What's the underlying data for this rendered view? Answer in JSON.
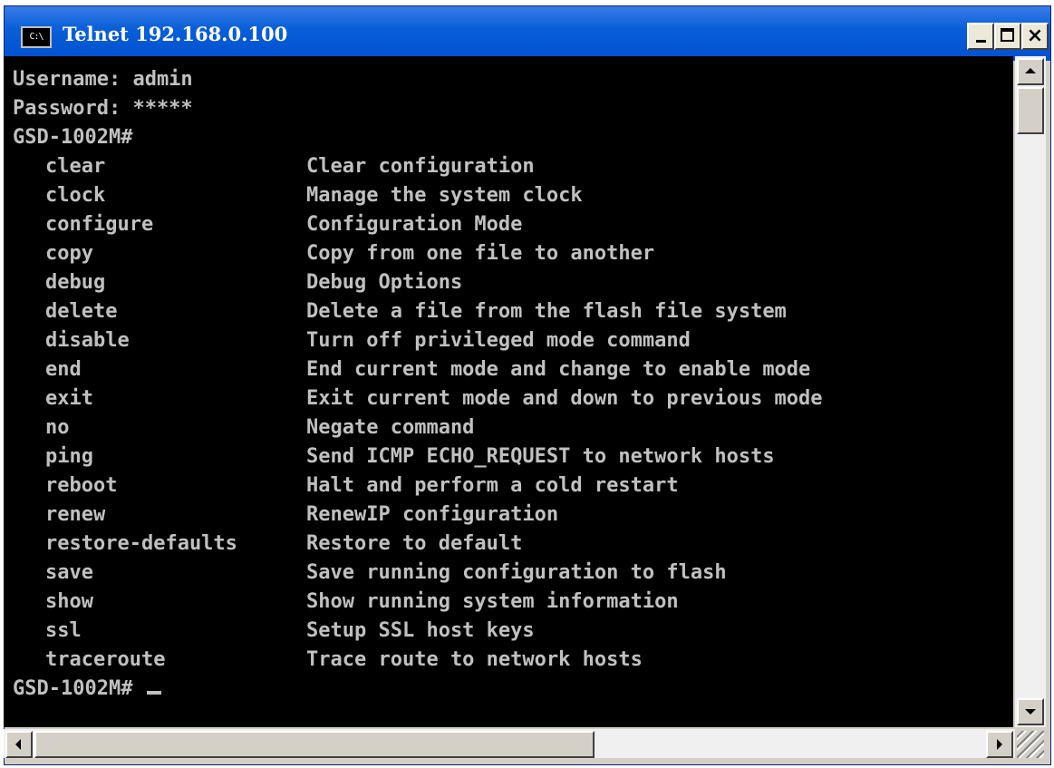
{
  "window": {
    "title": "Telnet 192.168.0.100",
    "icon_text": "C:\\"
  },
  "terminal": {
    "pre_lines": [
      "Username: admin",
      "Password: *****",
      "GSD-1002M#"
    ],
    "commands": [
      {
        "cmd": "clear",
        "desc": "Clear configuration"
      },
      {
        "cmd": "clock",
        "desc": "Manage the system clock"
      },
      {
        "cmd": "configure",
        "desc": "Configuration Mode"
      },
      {
        "cmd": "copy",
        "desc": "Copy from one file to another"
      },
      {
        "cmd": "debug",
        "desc": "Debug Options"
      },
      {
        "cmd": "delete",
        "desc": "Delete a file from the flash file system"
      },
      {
        "cmd": "disable",
        "desc": "Turn off privileged mode command"
      },
      {
        "cmd": "end",
        "desc": "End current mode and change to enable mode"
      },
      {
        "cmd": "exit",
        "desc": "Exit current mode and down to previous mode"
      },
      {
        "cmd": "no",
        "desc": "Negate command"
      },
      {
        "cmd": "ping",
        "desc": "Send ICMP ECHO_REQUEST to network hosts"
      },
      {
        "cmd": "reboot",
        "desc": "Halt and perform a cold restart"
      },
      {
        "cmd": "renew",
        "desc": "RenewIP configuration"
      },
      {
        "cmd": "restore-defaults",
        "desc": "Restore to default"
      },
      {
        "cmd": "save",
        "desc": "Save running configuration to flash"
      },
      {
        "cmd": "show",
        "desc": "Show running system information"
      },
      {
        "cmd": "ssl",
        "desc": "Setup SSL host keys"
      },
      {
        "cmd": "traceroute",
        "desc": "Trace route to network hosts"
      }
    ],
    "final_prompt": "GSD-1002M# "
  },
  "colors": {
    "terminal_bg": "#000000",
    "terminal_fg": "#c0c0c0",
    "titlebar": "#0a5fd8"
  }
}
